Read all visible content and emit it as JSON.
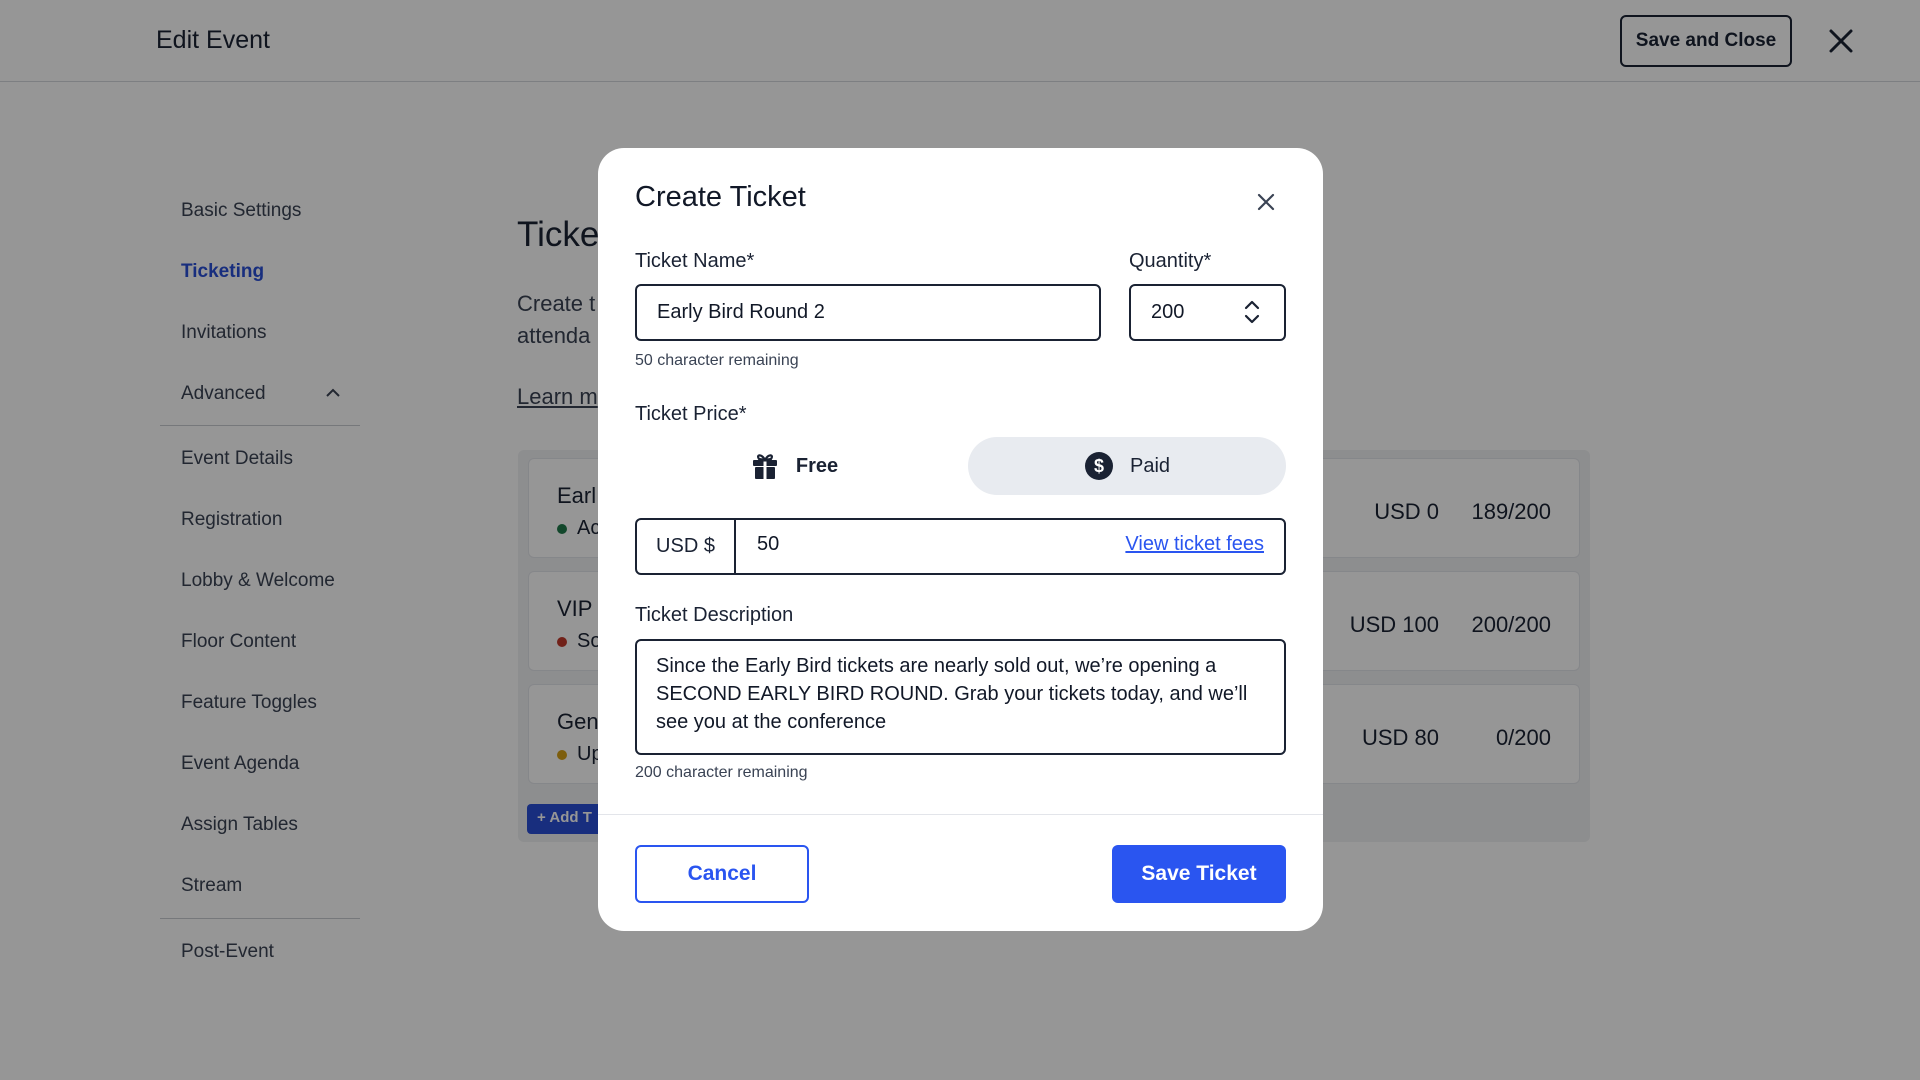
{
  "header": {
    "title": "Edit Event",
    "save_close_label": "Save and Close"
  },
  "sidebar": {
    "items": [
      {
        "label": "Basic Settings"
      },
      {
        "label": "Ticketing",
        "active": true
      },
      {
        "label": "Invitations"
      },
      {
        "label": "Advanced",
        "expanded": true
      },
      {
        "label": "Event Details"
      },
      {
        "label": "Registration"
      },
      {
        "label": "Lobby & Welcome"
      },
      {
        "label": "Floor Content"
      },
      {
        "label": "Feature Toggles"
      },
      {
        "label": "Event Agenda"
      },
      {
        "label": "Assign Tables"
      },
      {
        "label": "Stream"
      },
      {
        "label": "Post-Event"
      }
    ]
  },
  "main": {
    "title": "Ticke",
    "desc_line1": "Create t",
    "desc_line2": "attenda",
    "learn_more": "Learn m",
    "tickets": [
      {
        "name": "Earl",
        "status": "Ac",
        "status_color": "#1f7a4a",
        "price": "USD 0",
        "quantity": "189/200"
      },
      {
        "name": "VIP",
        "status": "So",
        "status_color": "#c0392b",
        "price": "USD 100",
        "quantity": "200/200"
      },
      {
        "name": "Gen",
        "status": "Up",
        "status_color": "#d4a017",
        "price": "USD 80",
        "quantity": "0/200"
      }
    ],
    "add_ticket_label": "Add T"
  },
  "modal": {
    "title": "Create Ticket",
    "ticket_name_label": "Ticket Name*",
    "ticket_name_value": "Early Bird Round 2",
    "ticket_name_hint": "50 character remaining",
    "quantity_label": "Quantity*",
    "quantity_value": "200",
    "price_label": "Ticket Price*",
    "price_options": [
      {
        "label": "Free",
        "icon": "gift-icon",
        "selected": false
      },
      {
        "label": "Paid",
        "icon": "dollar-circle-icon",
        "selected": true
      }
    ],
    "currency": "USD $",
    "price_value": "50",
    "view_fees_label": "View ticket fees",
    "description_label": "Ticket Description",
    "description_value": "Since the Early Bird tickets are nearly sold out, we’re opening a SECOND EARLY BIRD ROUND. Grab your tickets today, and we’ll see you at the conference",
    "description_hint": "200 character remaining",
    "cancel_label": "Cancel",
    "save_label": "Save  Ticket"
  },
  "colors": {
    "accent": "#2a55f0",
    "sidebar_active": "#2a4fd6",
    "overlay": "rgba(0,0,0,0.41)"
  }
}
